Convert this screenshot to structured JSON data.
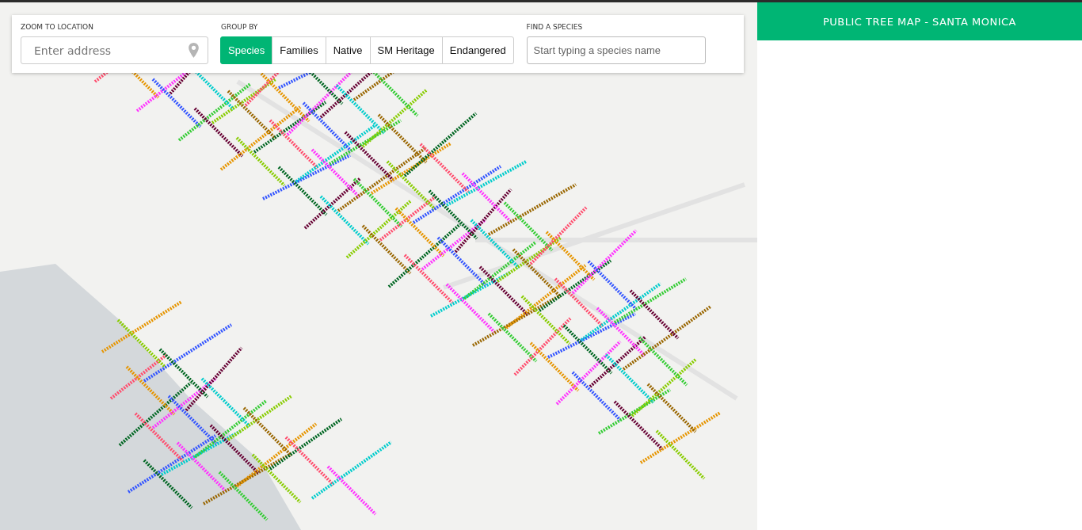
{
  "location": {
    "label": "ZOOM TO LOCATION",
    "placeholder": "Enter address"
  },
  "group_by": {
    "label": "GROUP BY",
    "options": [
      {
        "label": "Species",
        "selected": true
      },
      {
        "label": "Families",
        "selected": false
      },
      {
        "label": "Native",
        "selected": false
      },
      {
        "label": "SM Heritage",
        "selected": false
      },
      {
        "label": "Endangered",
        "selected": false
      }
    ]
  },
  "find_species": {
    "label": "FIND A SPECIES",
    "placeholder": "Start typing a species name"
  },
  "panel": {
    "title": "PUBLIC TREE MAP - SANTA MONICA"
  }
}
